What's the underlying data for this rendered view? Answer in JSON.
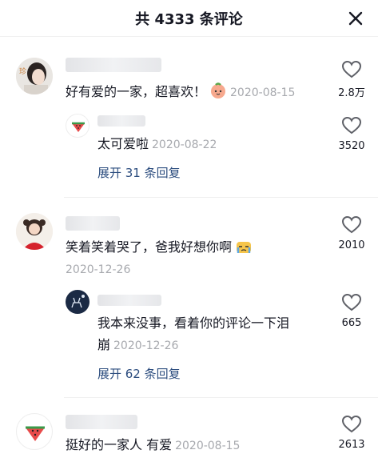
{
  "header": {
    "title": "共 4333 条评论"
  },
  "comments": [
    {
      "text": "好有爱的一家，超喜欢！",
      "date": "2020-08-15",
      "likes": "2.8万",
      "reply": {
        "text": "太可爱啦",
        "date": "2020-08-22",
        "likes": "3520"
      },
      "expand": "展开 31 条回复"
    },
    {
      "text": "笑着笑着哭了，爸我好想你啊",
      "date": "2020-12-26",
      "likes": "2010",
      "reply": {
        "text_line1": "我本来没事，看着你的评论一下泪",
        "text_line2": "崩",
        "date": "2020-12-26",
        "likes": "665"
      },
      "expand": "展开 62 条回复"
    },
    {
      "text": "挺好的一家人 有爱",
      "date": "2020-08-15",
      "likes": "2613"
    }
  ],
  "icons": {
    "close": "close-icon",
    "like": "heart-outline-icon",
    "watermelon": "watermelon-avatar-icon"
  }
}
